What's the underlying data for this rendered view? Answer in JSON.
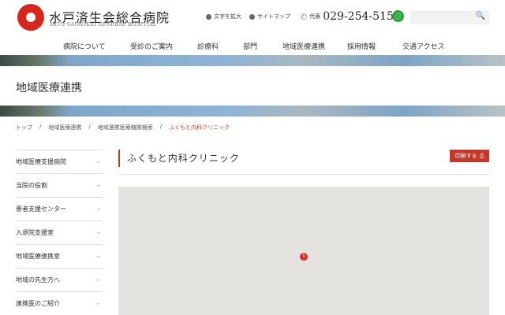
{
  "header": {
    "logo_title": "水戸済生会総合病院",
    "logo_subtitle": "MITO SAISEIKAI GENERAL HOSPITAL",
    "text_enlarge": "文字を拡大",
    "sitemap": "サイトマップ",
    "phone_label": "代表",
    "phone_number": "029-254-5151",
    "search_icon": "🔍"
  },
  "nav": [
    "病院について",
    "受診のご案内",
    "診療科",
    "部門",
    "地域医療連携",
    "採用情報",
    "交通アクセス"
  ],
  "page_title": "地域医療連携",
  "breadcrumb": [
    "トップ",
    "地域医療連携",
    "地域連携医療機関検索",
    "ふくもと内科クリニック"
  ],
  "sidebar": [
    "地域医療支援病院",
    "当院の役割",
    "患者支援センター",
    "入退院支援室",
    "地域医療連携室",
    "地域の先生方へ",
    "連携医のご紹介"
  ],
  "content": {
    "title": "ふくもと内科クリニック",
    "print_label": "印刷する",
    "print_icon": "⎙",
    "map_pin": "1"
  },
  "colors": {
    "accent": "#c0392b"
  }
}
